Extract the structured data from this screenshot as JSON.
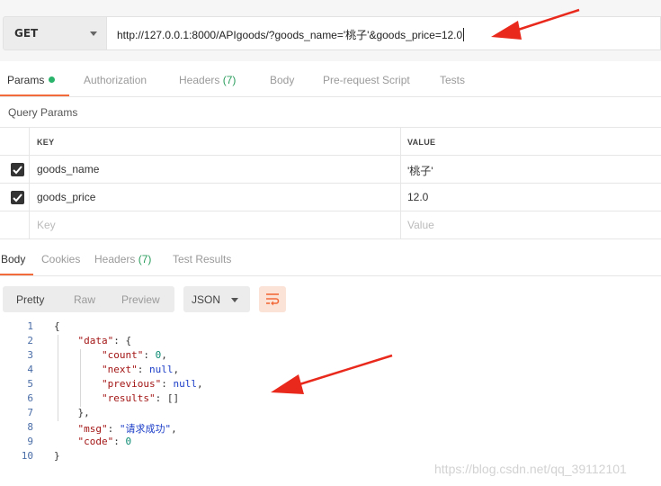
{
  "request": {
    "method": "GET",
    "url": "http://127.0.0.1:8000/APIgoods/?goods_name='桃子'&goods_price=12.0"
  },
  "request_tabs": [
    {
      "label": "Params"
    },
    {
      "label": "Authorization"
    },
    {
      "label": "Headers",
      "count": "(7)"
    },
    {
      "label": "Body"
    },
    {
      "label": "Pre-request Script"
    },
    {
      "label": "Tests"
    }
  ],
  "query_params": {
    "title": "Query Params",
    "headers": {
      "key": "KEY",
      "value": "VALUE"
    },
    "rows": [
      {
        "key": "goods_name",
        "value": "'桃子'",
        "checked": true
      },
      {
        "key": "goods_price",
        "value": "12.0",
        "checked": true
      }
    ],
    "placeholder": {
      "key": "Key",
      "value": "Value"
    }
  },
  "response_tabs": [
    {
      "label": "Body"
    },
    {
      "label": "Cookies"
    },
    {
      "label": "Headers",
      "count": "(7)"
    },
    {
      "label": "Test Results"
    }
  ],
  "view_modes": [
    "Pretty",
    "Raw",
    "Preview"
  ],
  "format": "JSON",
  "response_body": {
    "line_numbers": [
      "1",
      "2",
      "3",
      "4",
      "5",
      "6",
      "7",
      "8",
      "9",
      "10"
    ],
    "count_key": "\"count\"",
    "count_val": "0",
    "next_key": "\"next\"",
    "next_val": "null",
    "previous_key": "\"previous\"",
    "previous_val": "null",
    "results_key": "\"results\"",
    "results_val": "[]",
    "data_key": "\"data\"",
    "msg_key": "\"msg\"",
    "msg_val": "\"请求成功\"",
    "code_key": "\"code\"",
    "code_val": "0"
  },
  "watermark": "https://blog.csdn.net/qq_39112101",
  "colors": {
    "accent": "#f26b3a",
    "active_dot": "#2ab36b",
    "arrow": "#e8291c"
  }
}
